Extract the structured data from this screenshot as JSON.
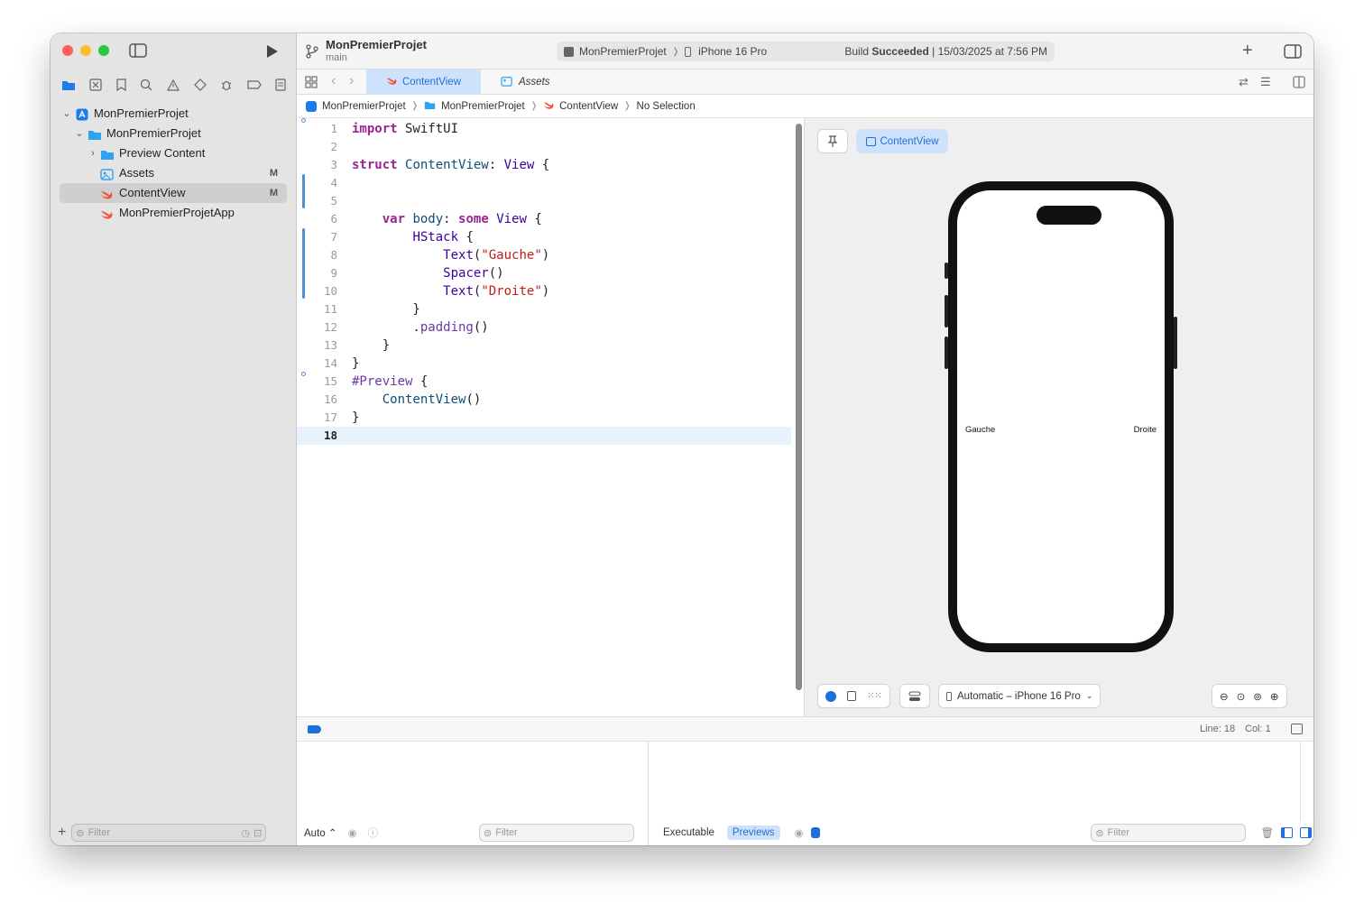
{
  "colors": {
    "accent": "#1e6fd9",
    "close": "#fe5f57",
    "minimize": "#febc2e",
    "zoom": "#28c840"
  },
  "toolbar": {
    "project": "MonPremierProjet",
    "branch": "main",
    "scheme": "MonPremierProjet",
    "device": "iPhone 16 Pro",
    "status_prefix": "Build ",
    "status_bold": "Succeeded",
    "status_suffix": " | 15/03/2025 at 7:56 PM"
  },
  "tabs": [
    {
      "label": "ContentView",
      "icon": "swift-icon"
    },
    {
      "label": "Assets",
      "icon": "assets-icon"
    }
  ],
  "breadcrumb": [
    "MonPremierProjet",
    "MonPremierProjet",
    "ContentView",
    "No Selection"
  ],
  "navigator": {
    "items": [
      {
        "label": "MonPremierProjet",
        "icon": "app-icon",
        "badge": ""
      },
      {
        "label": "MonPremierProjet",
        "icon": "folder-icon",
        "badge": ""
      },
      {
        "label": "Preview Content",
        "icon": "folder-icon",
        "badge": ""
      },
      {
        "label": "Assets",
        "icon": "assets-icon",
        "badge": "M"
      },
      {
        "label": "ContentView",
        "icon": "swift-icon",
        "badge": "M"
      },
      {
        "label": "MonPremierProjetApp",
        "icon": "swift-icon",
        "badge": ""
      }
    ],
    "filter_placeholder": "Filter"
  },
  "editor": {
    "line_numbers": [
      "1",
      "2",
      "3",
      "4",
      "5",
      "6",
      "7",
      "8",
      "9",
      "10",
      "11",
      "12",
      "13",
      "14",
      "15",
      "16",
      "17",
      "18"
    ],
    "current_line": "18"
  },
  "canvas": {
    "preview_label": "ContentView",
    "device_selector": "Automatic – iPhone 16 Pro",
    "preview_left": "Gauche",
    "preview_right": "Droite"
  },
  "debug": {
    "position_line": "Line: 18",
    "position_col": "Col: 1",
    "auto_label": "Auto ⌃",
    "filter_placeholder": "Filter",
    "executable": "Executable",
    "previews": "Previews"
  }
}
